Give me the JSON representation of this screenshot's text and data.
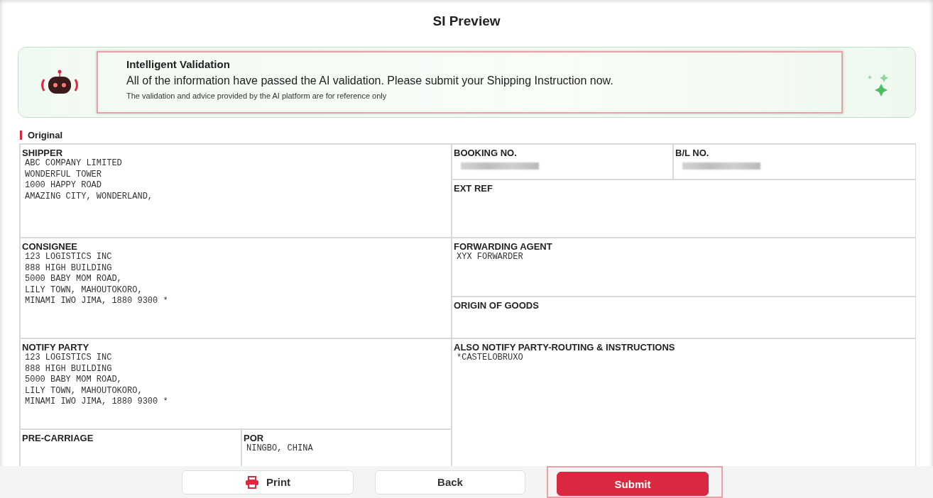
{
  "title": "SI Preview",
  "validation": {
    "title": "Intelligent Validation",
    "message": "All of the information have passed the AI validation. Please submit your Shipping Instruction now.",
    "note": "The validation and advice provided by the AI platform are for reference only",
    "highlighted": true
  },
  "section_label": "Original",
  "fields": [
    {
      "label": "SHIPPER",
      "lines": [
        "ABC COMPANY LIMITED",
        "WONDERFUL TOWER",
        "1000 HAPPY ROAD",
        "AMAZING CITY, WONDERLAND,"
      ],
      "redacted": false
    },
    {
      "label": "BOOKING NO.",
      "redacted": true
    },
    {
      "label": "B/L NO.",
      "redacted": true
    },
    {
      "label": "EXT REF",
      "redacted": false
    },
    {
      "label": "CONSIGNEE",
      "lines": [
        "123 LOGISTICS INC",
        "888 HIGH BUILDING",
        "5000 BABY MOM ROAD,",
        "LILY TOWN, MAHOUTOKORO,",
        "MINAMI IWO JIMA, 1880 9300 *"
      ],
      "redacted": false
    },
    {
      "label": "FORWARDING AGENT",
      "lines": [
        "XYX FORWARDER"
      ],
      "redacted": false
    },
    {
      "label": "ORIGIN OF GOODS",
      "redacted": false
    },
    {
      "label": "NOTIFY PARTY",
      "lines": [
        "123 LOGISTICS INC",
        "888 HIGH BUILDING",
        "5000 BABY MOM ROAD,",
        "LILY TOWN, MAHOUTOKORO,",
        "MINAMI IWO JIMA, 1880 9300 *"
      ],
      "redacted": false
    },
    {
      "label": "ALSO NOTIFY PARTY-ROUTING & INSTRUCTIONS",
      "lines": [
        "*CASTELOBRUXO"
      ],
      "redacted": false
    },
    {
      "label": "PRE-CARRIAGE",
      "redacted": false
    },
    {
      "label": "POR",
      "lines": [
        "NINGBO, CHINA"
      ],
      "redacted": false
    }
  ],
  "buttons": [
    {
      "label": "Print",
      "kind": "print",
      "highlighted": false
    },
    {
      "label": "Back",
      "kind": "back",
      "highlighted": false
    },
    {
      "label": "Submit",
      "kind": "submit",
      "highlighted": true
    }
  ]
}
